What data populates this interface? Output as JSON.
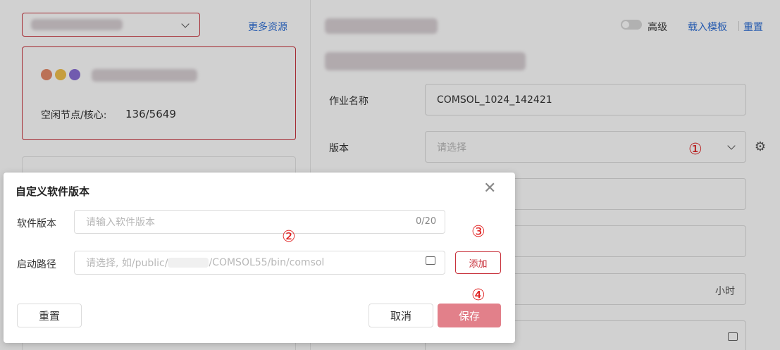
{
  "left_panel": {
    "more_resources": "更多资源",
    "idle_label": "空闲节点/核心:",
    "idle_value": "136/5649"
  },
  "right_panel": {
    "advanced_label": "高级",
    "load_template": "载入模板",
    "reset": "重置",
    "job_name_label": "作业名称",
    "job_name_value": "COMSOL_1024_142421",
    "version_label": "版本",
    "version_placeholder": "请选择",
    "hours_unit": "小时"
  },
  "dialog": {
    "title": "自定义软件版本",
    "software_version_label": "软件版本",
    "software_version_placeholder": "请输入软件版本",
    "counter": "0/20",
    "start_path_label": "启动路径",
    "start_path_placeholder_prefix": "请选择, 如/public/",
    "start_path_placeholder_suffix": "/COMSOL55/bin/comsol",
    "add_button": "添加",
    "reset_button": "重置",
    "cancel_button": "取消",
    "save_button": "保存"
  },
  "annotations": {
    "step1": "①",
    "step2": "②",
    "step3": "③",
    "step4": "④"
  },
  "colors": {
    "accent_red": "#c8323c",
    "link_blue": "#2f6fd6",
    "save_pink": "#e2808a"
  },
  "icons": {
    "close": "close-icon",
    "gear": "gear-icon",
    "folder": "folder-icon",
    "chevron": "chevron-down-icon"
  }
}
